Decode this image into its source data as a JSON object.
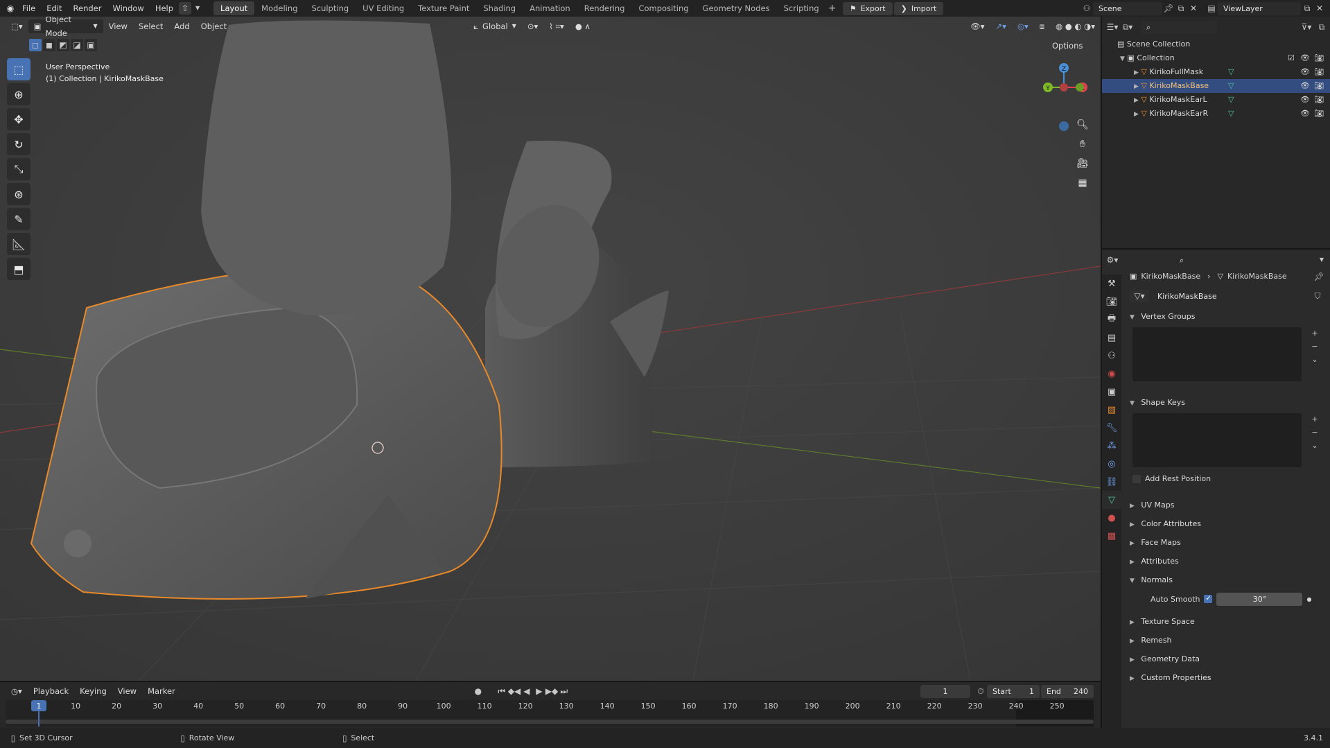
{
  "topbar": {
    "menus": [
      "File",
      "Edit",
      "Render",
      "Window",
      "Help"
    ],
    "workspaces": [
      "Layout",
      "Modeling",
      "Sculpting",
      "UV Editing",
      "Texture Paint",
      "Shading",
      "Animation",
      "Rendering",
      "Compositing",
      "Geometry Nodes",
      "Scripting"
    ],
    "active_workspace": "Layout",
    "export_label": "Export",
    "import_label": "Import",
    "scene": "Scene",
    "view_layer": "ViewLayer"
  },
  "viewport": {
    "mode": "Object Mode",
    "menus": [
      "View",
      "Select",
      "Add",
      "Object"
    ],
    "orientation": "Global",
    "options_label": "Options",
    "perspective_label": "User Perspective",
    "collection_label": "(1) Collection | KirikoMaskBase"
  },
  "outliner": {
    "scene_collection": "Scene Collection",
    "collection": "Collection",
    "objects": [
      "KirikoFullMask",
      "KirikoMaskBase",
      "KirikoMaskEarL",
      "KirikoMaskEarR"
    ],
    "selected": "KirikoMaskBase"
  },
  "properties": {
    "breadcrumb_object": "KirikoMaskBase",
    "breadcrumb_data": "KirikoMaskBase",
    "datablock_name": "KirikoMaskBase",
    "panels": {
      "vertex_groups": "Vertex Groups",
      "shape_keys": "Shape Keys",
      "add_rest_position": "Add Rest Position",
      "uv_maps": "UV Maps",
      "color_attributes": "Color Attributes",
      "face_maps": "Face Maps",
      "attributes": "Attributes",
      "normals": "Normals",
      "auto_smooth": "Auto Smooth",
      "auto_smooth_angle": "30°",
      "texture_space": "Texture Space",
      "remesh": "Remesh",
      "geometry_data": "Geometry Data",
      "custom_properties": "Custom Properties"
    }
  },
  "timeline": {
    "menus": [
      "Playback",
      "Keying",
      "View",
      "Marker"
    ],
    "current_frame": "1",
    "start_label": "Start",
    "start": "1",
    "end_label": "End",
    "end": "240",
    "ticks": [
      "1",
      "10",
      "20",
      "30",
      "40",
      "50",
      "60",
      "70",
      "80",
      "90",
      "100",
      "110",
      "120",
      "130",
      "140",
      "150",
      "160",
      "170",
      "180",
      "190",
      "200",
      "210",
      "220",
      "230",
      "240",
      "250"
    ]
  },
  "statusbar": {
    "left": "Set 3D Cursor",
    "middle": "Rotate View",
    "right": "Select",
    "version": "3.4.1"
  },
  "colors": {
    "selection_outline": "#e88a2a",
    "accent": "#4772b3",
    "x_axis": "#e0434e",
    "y_axis": "#7fba2a",
    "z_axis": "#4a8fd6"
  }
}
